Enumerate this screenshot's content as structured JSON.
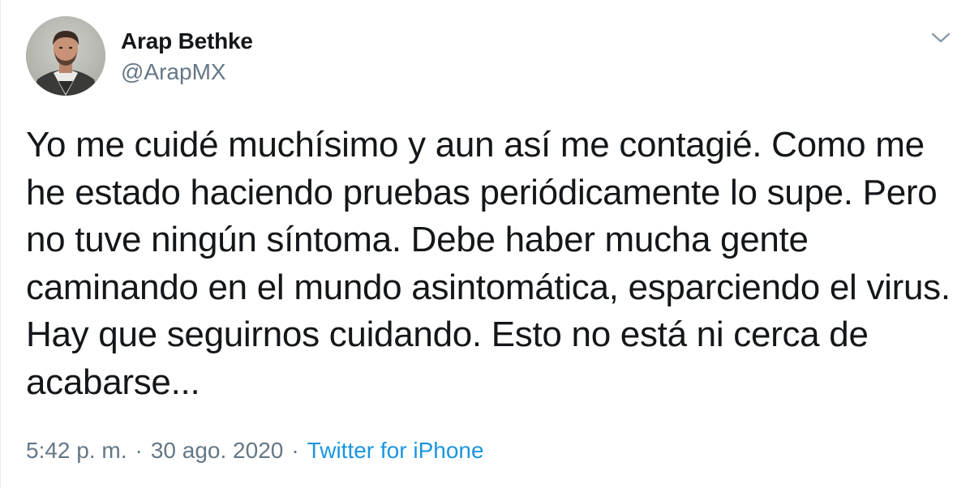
{
  "tweet": {
    "author": {
      "display_name": "Arap Bethke",
      "handle": "@ArapMX"
    },
    "text": "Yo me cuidé muchísimo y aun así me contagié. Como me he estado haciendo pruebas periódicamente lo supe. Pero no tuve ningún síntoma. Debe haber mucha gente caminando en el mundo asintomática, esparciendo el virus. Hay que seguirnos cuidando. Esto no está ni cerca de acabarse...",
    "time": "5:42 p. m.",
    "date": "30 ago. 2020",
    "separator": "·",
    "source": "Twitter for iPhone"
  },
  "colors": {
    "text": "#14171a",
    "secondary": "#657786",
    "link": "#1b95e0"
  },
  "icons": {
    "avatar": "profile-photo",
    "menu": "chevron-down-icon"
  }
}
